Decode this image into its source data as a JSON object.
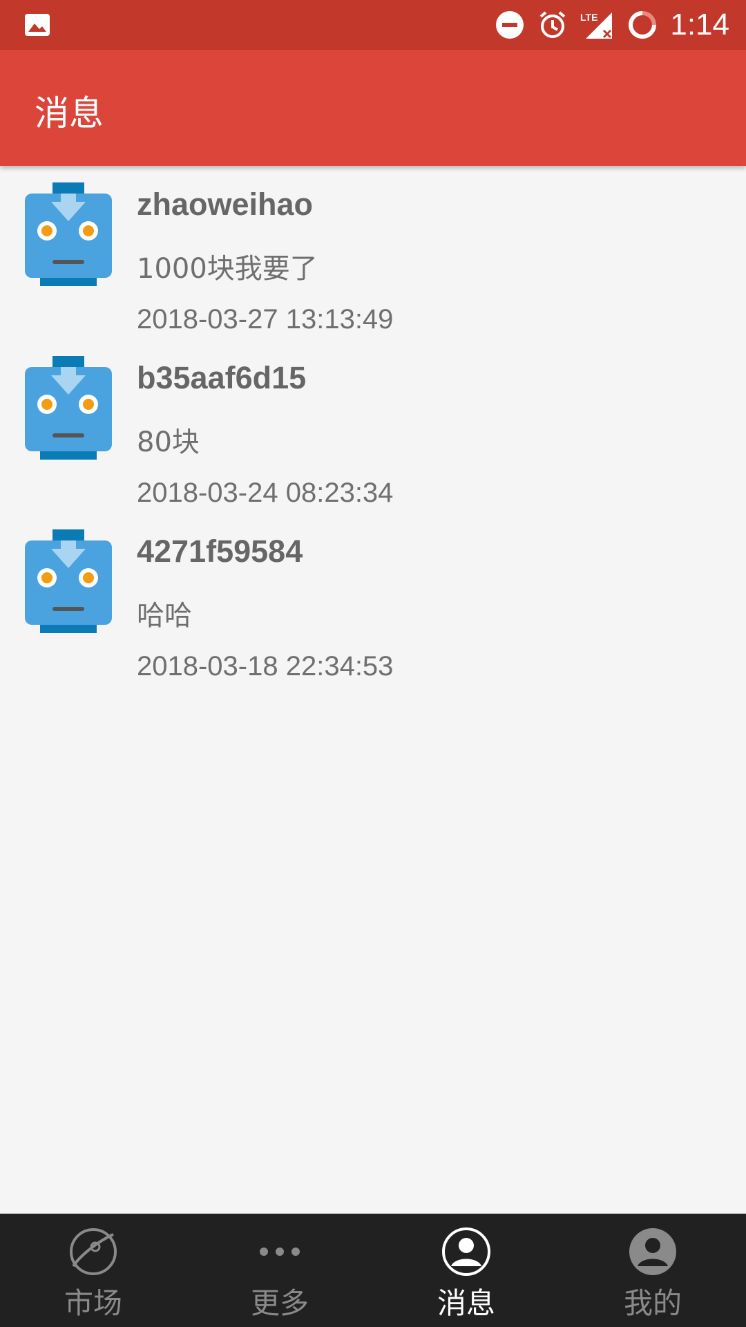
{
  "status_bar": {
    "time": "1:14",
    "icons": [
      "image-icon",
      "do-not-disturb-icon",
      "alarm-icon",
      "lte-signal-icon",
      "battery-icon"
    ],
    "network_label": "LTE"
  },
  "app_bar": {
    "title": "消息",
    "color": "#db453a"
  },
  "messages": [
    {
      "user": "zhaoweihao",
      "content": "1000块我要了",
      "time": "2018-03-27 13:13:49",
      "avatar": "robot-avatar-icon"
    },
    {
      "user": "b35aaf6d15",
      "content": "80块",
      "time": "2018-03-24 08:23:34",
      "avatar": "robot-avatar-icon"
    },
    {
      "user": "4271f59584",
      "content": "哈哈",
      "time": "2018-03-18 22:34:53",
      "avatar": "robot-avatar-icon"
    }
  ],
  "bottom_nav": {
    "items": [
      {
        "label": "市场",
        "icon": "planet-icon",
        "active": false
      },
      {
        "label": "更多",
        "icon": "more-dots-icon",
        "active": false
      },
      {
        "label": "消息",
        "icon": "person-icon",
        "active": true
      },
      {
        "label": "我的",
        "icon": "profile-icon",
        "active": false
      }
    ]
  },
  "colors": {
    "status_bar": "#c2392b",
    "app_bar": "#db453a",
    "background": "#f5f5f5",
    "nav_background": "#212121",
    "avatar_blue": "#4aa3df",
    "avatar_dark_blue": "#0b7bb5",
    "avatar_eye": "#f39c12"
  }
}
